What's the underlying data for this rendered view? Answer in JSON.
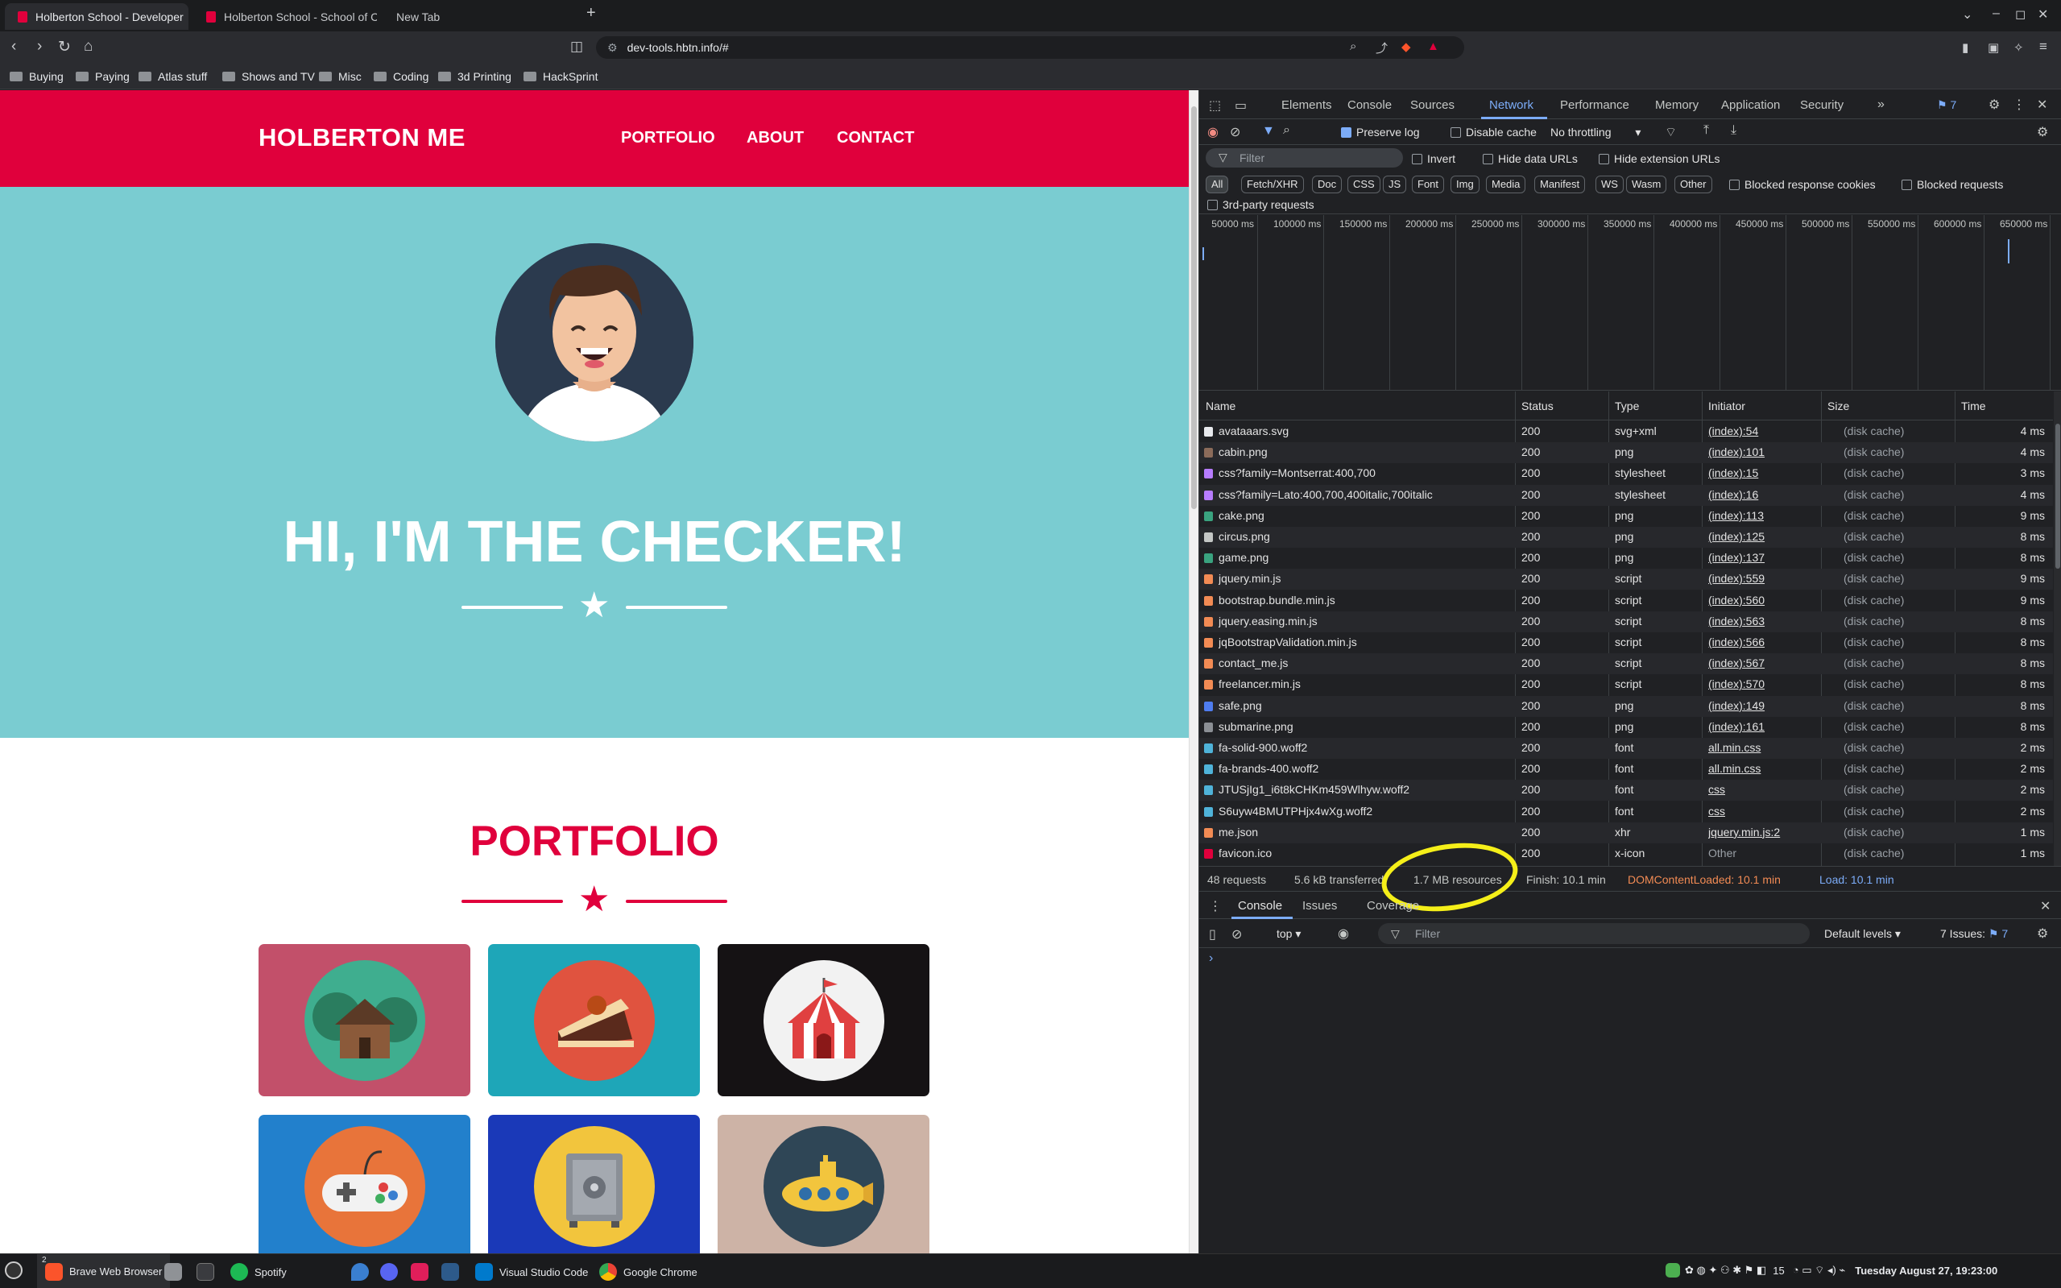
{
  "browser": {
    "tabs": [
      {
        "title": "Holberton School - Developer"
      },
      {
        "title": "Holberton School - School of Co"
      },
      {
        "title": "New Tab"
      }
    ],
    "new_tab": "+",
    "url": "dev-tools.hbtn.info/#",
    "bookmarks": [
      "Buying",
      "Paying",
      "Atlas stuff",
      "Shows and TV",
      "Misc",
      "Coding",
      "3d Printing",
      "HackSprint"
    ]
  },
  "site": {
    "brand": "HOLBERTON ME",
    "nav": [
      "PORTFOLIO",
      "ABOUT",
      "CONTACT"
    ],
    "hero_title": "HI, I'M THE CHECKER!",
    "portfolio_title": "PORTFOLIO",
    "colors": {
      "primary": "#e0003c",
      "hero": "#7accd1"
    },
    "portfolio_items": [
      {
        "icon": "cabin-icon",
        "bg": "#c2506a",
        "circle": "#3fae8f"
      },
      {
        "icon": "cake-icon",
        "bg": "#1ea6b8",
        "circle": "#e0533f"
      },
      {
        "icon": "circus-icon",
        "bg": "#151214",
        "circle": "#f2f2f2"
      },
      {
        "icon": "game-icon",
        "bg": "#2280cc",
        "circle": "#e8743a"
      },
      {
        "icon": "safe-icon",
        "bg": "#1a39b8",
        "circle": "#f2c53d"
      },
      {
        "icon": "submarine-icon",
        "bg": "#cdb3a6",
        "circle": "#2f4656"
      }
    ]
  },
  "devtools": {
    "tabs": [
      "Elements",
      "Console",
      "Sources",
      "Network",
      "Performance",
      "Memory",
      "Application",
      "Security"
    ],
    "issues_badge": "7",
    "toolbar": {
      "preserve_log": "Preserve log",
      "disable_cache": "Disable cache",
      "throttling": "No throttling"
    },
    "filter": {
      "placeholder": "Filter",
      "invert": "Invert",
      "hide_data": "Hide data URLs",
      "hide_ext": "Hide extension URLs"
    },
    "types": [
      "All",
      "Fetch/XHR",
      "Doc",
      "CSS",
      "JS",
      "Font",
      "Img",
      "Media",
      "Manifest",
      "WS",
      "Wasm",
      "Other"
    ],
    "blocked_cookies": "Blocked response cookies",
    "blocked_requests": "Blocked requests",
    "third_party": "3rd-party requests",
    "timeline": [
      "50000 ms",
      "100000 ms",
      "150000 ms",
      "200000 ms",
      "250000 ms",
      "300000 ms",
      "350000 ms",
      "400000 ms",
      "450000 ms",
      "500000 ms",
      "550000 ms",
      "600000 ms",
      "650000 ms"
    ],
    "columns": [
      "Name",
      "Status",
      "Type",
      "Initiator",
      "Size",
      "Time"
    ],
    "rows": [
      {
        "name": "avataaars.svg",
        "status": "200",
        "type": "svg+xml",
        "initiator": "(index):54",
        "size": "(disk cache)",
        "time": "4 ms",
        "color": "#e8eaed"
      },
      {
        "name": "cabin.png",
        "status": "200",
        "type": "png",
        "initiator": "(index):101",
        "size": "(disk cache)",
        "time": "4 ms",
        "color": "#8b6b5a"
      },
      {
        "name": "css?family=Montserrat:400,700",
        "status": "200",
        "type": "stylesheet",
        "initiator": "(index):15",
        "size": "(disk cache)",
        "time": "3 ms",
        "color": "#b77cff"
      },
      {
        "name": "css?family=Lato:400,700,400italic,700italic",
        "status": "200",
        "type": "stylesheet",
        "initiator": "(index):16",
        "size": "(disk cache)",
        "time": "4 ms",
        "color": "#b77cff"
      },
      {
        "name": "cake.png",
        "status": "200",
        "type": "png",
        "initiator": "(index):113",
        "size": "(disk cache)",
        "time": "9 ms",
        "color": "#3aa37f"
      },
      {
        "name": "circus.png",
        "status": "200",
        "type": "png",
        "initiator": "(index):125",
        "size": "(disk cache)",
        "time": "8 ms",
        "color": "#c4c7c5"
      },
      {
        "name": "game.png",
        "status": "200",
        "type": "png",
        "initiator": "(index):137",
        "size": "(disk cache)",
        "time": "8 ms",
        "color": "#3aa37f"
      },
      {
        "name": "jquery.min.js",
        "status": "200",
        "type": "script",
        "initiator": "(index):559",
        "size": "(disk cache)",
        "time": "9 ms",
        "color": "#f28b54"
      },
      {
        "name": "bootstrap.bundle.min.js",
        "status": "200",
        "type": "script",
        "initiator": "(index):560",
        "size": "(disk cache)",
        "time": "9 ms",
        "color": "#f28b54"
      },
      {
        "name": "jquery.easing.min.js",
        "status": "200",
        "type": "script",
        "initiator": "(index):563",
        "size": "(disk cache)",
        "time": "8 ms",
        "color": "#f28b54"
      },
      {
        "name": "jqBootstrapValidation.min.js",
        "status": "200",
        "type": "script",
        "initiator": "(index):566",
        "size": "(disk cache)",
        "time": "8 ms",
        "color": "#f28b54"
      },
      {
        "name": "contact_me.js",
        "status": "200",
        "type": "script",
        "initiator": "(index):567",
        "size": "(disk cache)",
        "time": "8 ms",
        "color": "#f28b54"
      },
      {
        "name": "freelancer.min.js",
        "status": "200",
        "type": "script",
        "initiator": "(index):570",
        "size": "(disk cache)",
        "time": "8 ms",
        "color": "#f28b54"
      },
      {
        "name": "safe.png",
        "status": "200",
        "type": "png",
        "initiator": "(index):149",
        "size": "(disk cache)",
        "time": "8 ms",
        "color": "#4f7df0"
      },
      {
        "name": "submarine.png",
        "status": "200",
        "type": "png",
        "initiator": "(index):161",
        "size": "(disk cache)",
        "time": "8 ms",
        "color": "#8b8f94"
      },
      {
        "name": "fa-solid-900.woff2",
        "status": "200",
        "type": "font",
        "initiator": "all.min.css",
        "size": "(disk cache)",
        "time": "2 ms",
        "color": "#4fb3d9"
      },
      {
        "name": "fa-brands-400.woff2",
        "status": "200",
        "type": "font",
        "initiator": "all.min.css",
        "size": "(disk cache)",
        "time": "2 ms",
        "color": "#4fb3d9"
      },
      {
        "name": "JTUSjIg1_i6t8kCHKm459Wlhyw.woff2",
        "status": "200",
        "type": "font",
        "initiator": "css",
        "size": "(disk cache)",
        "time": "2 ms",
        "color": "#4fb3d9"
      },
      {
        "name": "S6uyw4BMUTPHjx4wXg.woff2",
        "status": "200",
        "type": "font",
        "initiator": "css",
        "size": "(disk cache)",
        "time": "2 ms",
        "color": "#4fb3d9"
      },
      {
        "name": "me.json",
        "status": "200",
        "type": "xhr",
        "initiator": "jquery.min.js:2",
        "size": "(disk cache)",
        "time": "1 ms",
        "color": "#f28b54"
      },
      {
        "name": "favicon.ico",
        "status": "200",
        "type": "x-icon",
        "initiator": "Other",
        "size": "(disk cache)",
        "time": "1 ms",
        "color": "#e0003c"
      }
    ],
    "summary": {
      "requests": "48 requests",
      "transferred": "5.6 kB transferred",
      "resources": "1.7 MB resources",
      "finish": "Finish: 10.1 min",
      "dcl": "DOMContentLoaded: 10.1 min",
      "load": "Load: 10.1 min"
    },
    "drawer_tabs": [
      "Console",
      "Issues",
      "Coverage"
    ],
    "console": {
      "context": "top",
      "filter_placeholder": "Filter",
      "levels": "Default levels",
      "issues": "7 Issues:",
      "issues_count": "7",
      "prompt": "›"
    }
  },
  "taskbar": {
    "apps": [
      "Brave Web Browser",
      "Spotify",
      "Visual Studio Code",
      "Google Chrome"
    ],
    "badge": "2",
    "status_num": "15",
    "clock": "Tuesday August 27, 19:23:00"
  }
}
